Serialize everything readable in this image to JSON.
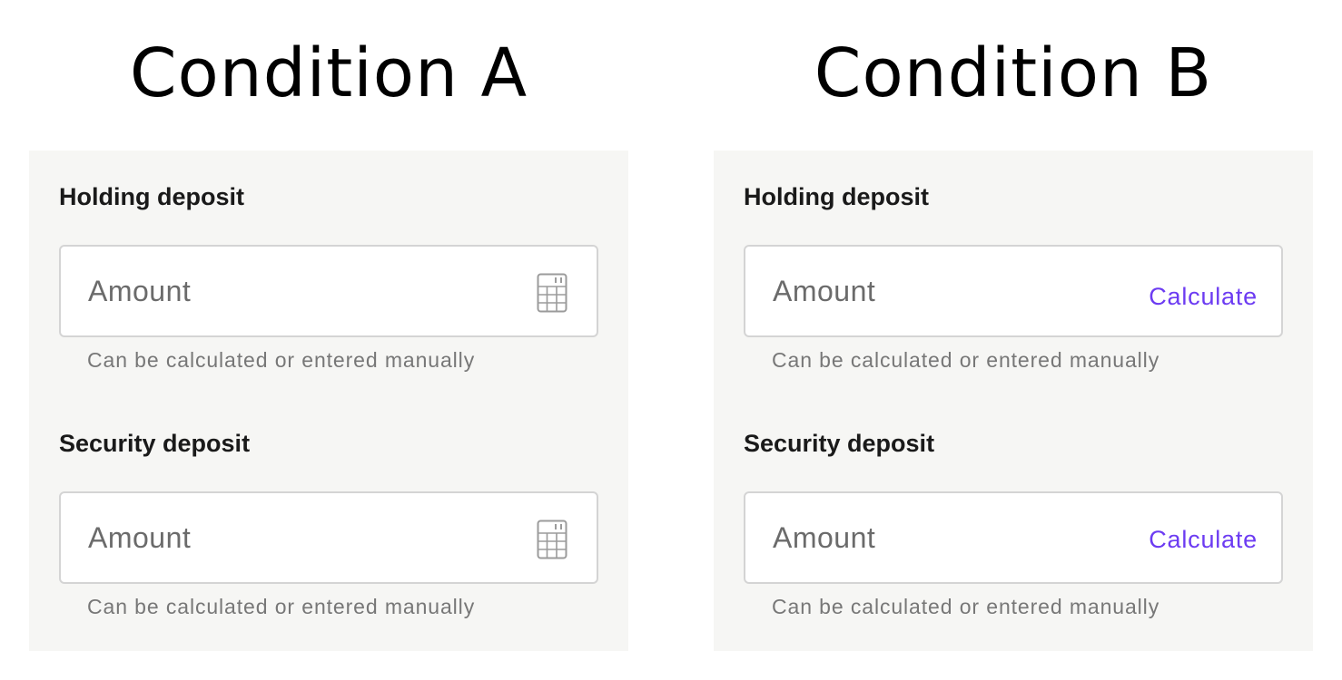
{
  "conditions": [
    {
      "heading": "Condition A",
      "fields": [
        {
          "label": "Holding deposit",
          "placeholder": "Amount",
          "helper": "Can be calculated or entered manually",
          "action_icon": "calculator-icon"
        },
        {
          "label": "Security deposit",
          "placeholder": "Amount",
          "helper": "Can be calculated or entered manually",
          "action_icon": "calculator-icon"
        }
      ]
    },
    {
      "heading": "Condition B",
      "fields": [
        {
          "label": "Holding deposit",
          "placeholder": "Amount",
          "helper": "Can be calculated or entered manually",
          "action_label": "Calculate"
        },
        {
          "label": "Security deposit",
          "placeholder": "Amount",
          "helper": "Can be calculated or entered manually",
          "action_label": "Calculate"
        }
      ]
    }
  ],
  "colors": {
    "panel_background": "#f6f6f4",
    "input_border": "#d4d4d4",
    "link_accent": "#6c3bf2",
    "helper_text": "#777777",
    "placeholder_text": "#6b6b6b"
  }
}
